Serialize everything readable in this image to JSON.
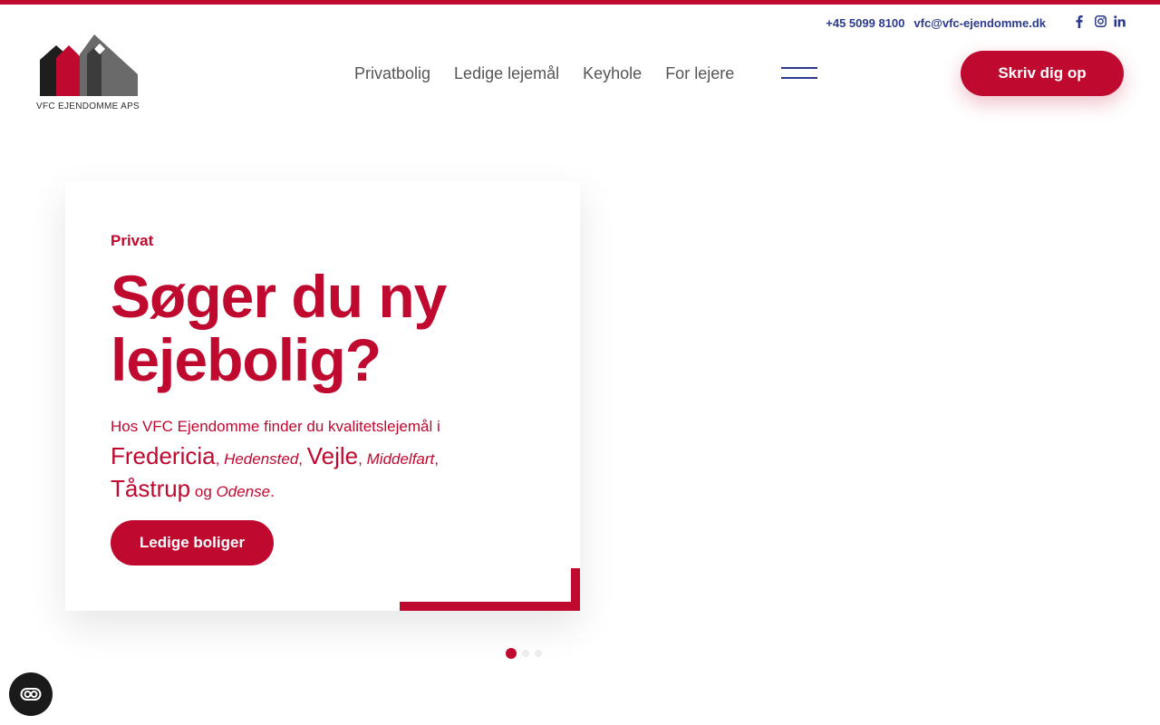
{
  "header": {
    "phone": "+45 5099 8100",
    "email": "vfc@vfc-ejendomme.dk",
    "social": [
      "facebook-icon",
      "instagram-icon",
      "linkedin-icon"
    ],
    "logo_text": "VFC EJENDOMME APS",
    "nav": [
      "Privatbolig",
      "Ledige lejemål",
      "Keyhole",
      "For lejere"
    ],
    "cta_label": "Skriv dig op"
  },
  "hero": {
    "eyebrow": "Privat",
    "headline": "Søger du ny lejebolig?",
    "intro": "Hos VFC Ejendomme finder du kvalitetslejemål i",
    "cities": [
      "Fredericia",
      "Hedensted",
      "Vejle",
      "Middelfart",
      "Tåstrup",
      "Odense"
    ],
    "sep": ",",
    "joiner": "og",
    "end": ".",
    "button_label": "Ledige boliger",
    "slides_total": 3,
    "slide_active": 1
  },
  "colors": {
    "brand": "#c0092f",
    "navy": "#2b3a8c"
  }
}
